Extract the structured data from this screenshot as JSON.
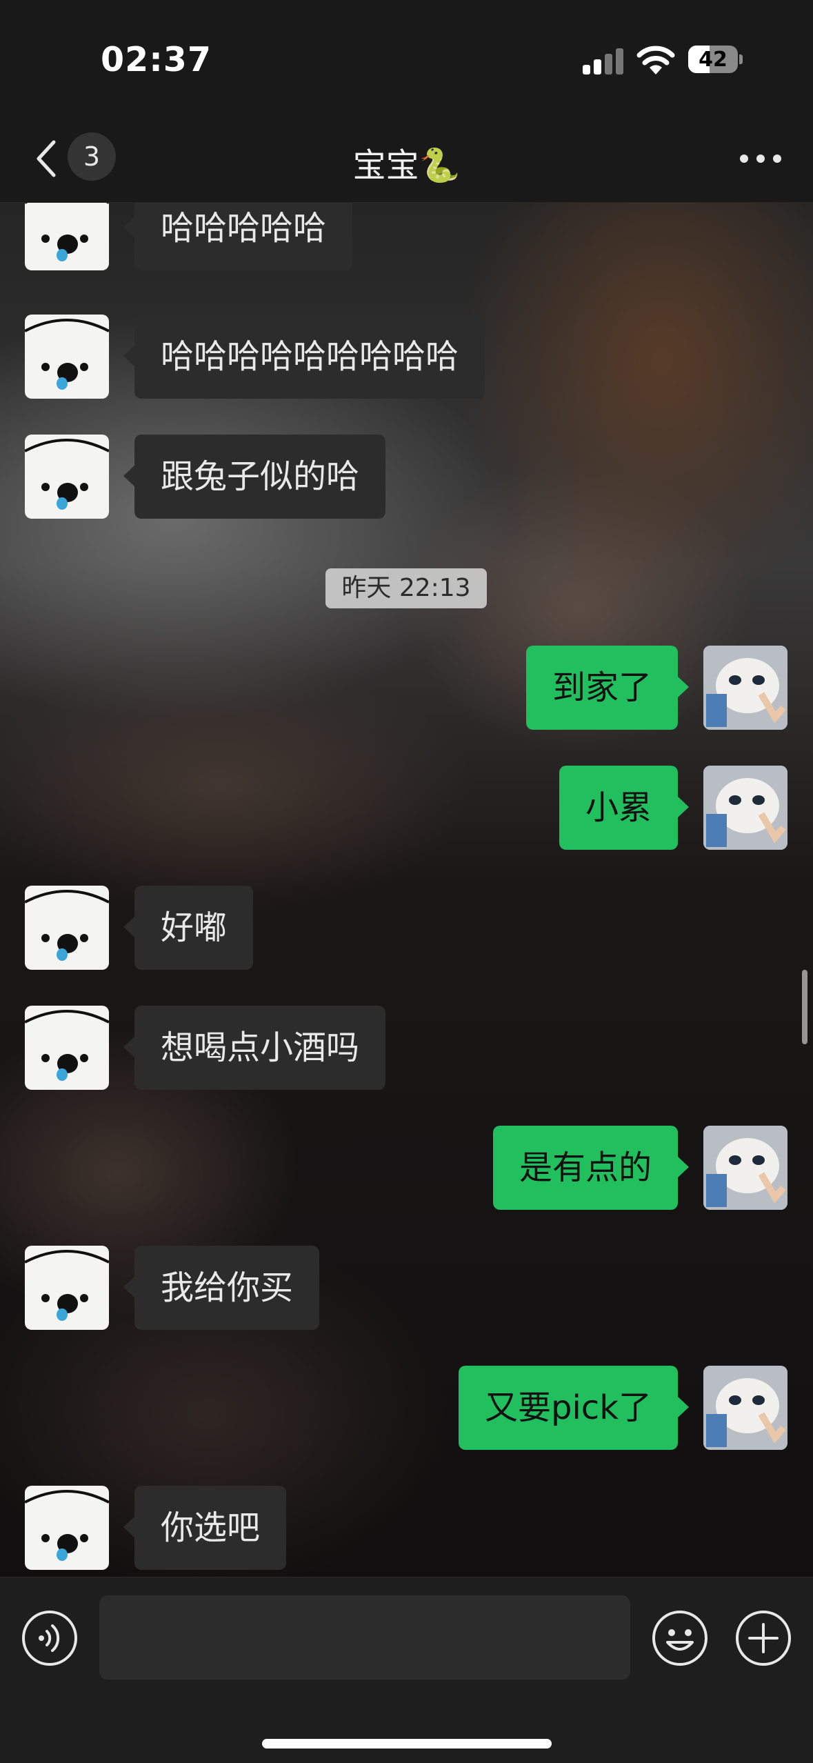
{
  "status_bar": {
    "time": "02:37",
    "battery_level": "42",
    "icons": [
      "cellular-signal-icon",
      "wifi-icon",
      "battery-icon"
    ]
  },
  "header": {
    "back_icon": "chevron-left-icon",
    "unread_count": "3",
    "title": "宝宝🐍",
    "more_icon": "more-dots-icon"
  },
  "messages": [
    {
      "sender": "other",
      "text": "哈哈哈哈哈"
    },
    {
      "sender": "other",
      "text": "哈哈哈哈哈哈哈哈哈"
    },
    {
      "sender": "other",
      "text": "跟兔子似的哈"
    },
    {
      "type": "timestamp",
      "text": "昨天 22:13"
    },
    {
      "sender": "me",
      "text": "到家了"
    },
    {
      "sender": "me",
      "text": "小累"
    },
    {
      "sender": "other",
      "text": "好嘟"
    },
    {
      "sender": "other",
      "text": "想喝点小酒吗"
    },
    {
      "sender": "me",
      "text": "是有点的"
    },
    {
      "sender": "other",
      "text": "我给你买"
    },
    {
      "sender": "me",
      "text": "又要pick了"
    },
    {
      "sender": "other",
      "text": "你选吧"
    }
  ],
  "input_bar": {
    "voice_icon": "voice-input-icon",
    "input_value": "",
    "emoji_icon": "emoji-icon",
    "plus_icon": "add-icon"
  },
  "colors": {
    "my_bubble": "#21bf5e",
    "other_bubble": "#2c2c2c",
    "bar_background": "#181918"
  }
}
